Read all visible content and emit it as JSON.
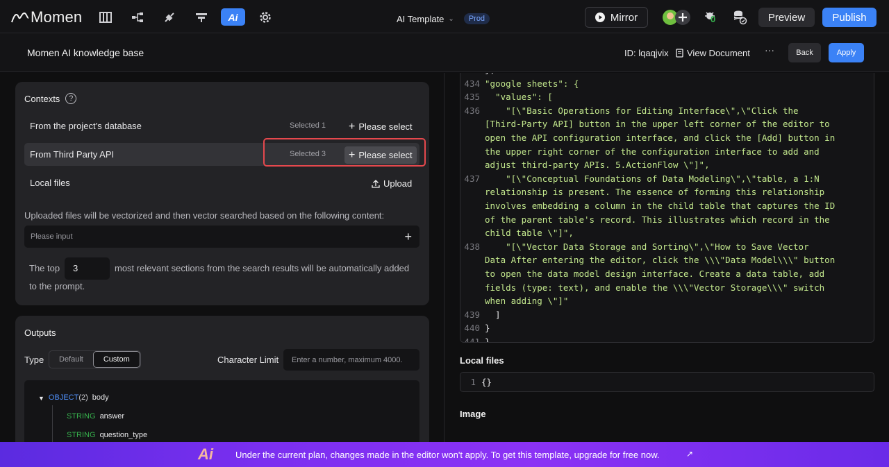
{
  "topbar": {
    "logo": "Momen",
    "template_name": "AI Template",
    "env_badge": "Prod",
    "mirror_label": "Mirror",
    "notification_count": "0",
    "preview_label": "Preview",
    "publish_label": "Publish"
  },
  "subbar": {
    "title": "Momen AI knowledge base",
    "id_text": "ID: lqaqjvix",
    "view_document": "View Document",
    "more": "···",
    "back_label": "Back",
    "apply_label": "Apply"
  },
  "contexts": {
    "title": "Contexts",
    "help": "?",
    "rows": [
      {
        "label": "From the project’s database",
        "selected": "Selected 1",
        "action": "Please select"
      },
      {
        "label": "From Third Party API",
        "selected": "Selected 3",
        "action": "Please select"
      },
      {
        "label": "Local files",
        "selected": "",
        "action": "Upload"
      }
    ],
    "hint": "Uploaded files will be vectorized and then vector searched based on the following content:",
    "input_placeholder": "Please input",
    "topn_prefix": "The top",
    "topn_value": "3",
    "topn_suffix": "most relevant sections from the search results will be automatically added",
    "topn_suffix2": "to the prompt."
  },
  "outputs": {
    "title": "Outputs",
    "type_label": "Type",
    "type_options": [
      "Default",
      "Custom"
    ],
    "type_selected": "Custom",
    "char_limit_label": "Character Limit",
    "char_limit_placeholder": "Enter a number, maximum 4000.",
    "tree": {
      "root_type": "OBJECT",
      "root_count": "(2)",
      "root_name": "body",
      "children": [
        {
          "type": "STRING",
          "name": "answer"
        },
        {
          "type": "STRING",
          "name": "question_type"
        }
      ]
    }
  },
  "code": {
    "lines": [
      {
        "n": "",
        "t": "},"
      },
      {
        "n": "434",
        "t": "\"google sheets\": {"
      },
      {
        "n": "435",
        "t": "  \"values\": ["
      },
      {
        "n": "436",
        "t": "    \"[\\\"Basic Operations for Editing Interface\\\",\\\"Click the"
      },
      {
        "n": "",
        "t": "[Third-Party API] button in the upper left corner of the editor to"
      },
      {
        "n": "",
        "t": "open the API configuration interface, and click the [Add] button in"
      },
      {
        "n": "",
        "t": "the upper right corner of the configuration interface to add and"
      },
      {
        "n": "",
        "t": "adjust third-party APIs. 5.ActionFlow \\\"]\","
      },
      {
        "n": "437",
        "t": "    \"[\\\"Conceptual Foundations of Data Modeling\\\",\\\"table, a 1:N"
      },
      {
        "n": "",
        "t": "relationship is present. The essence of forming this relationship"
      },
      {
        "n": "",
        "t": "involves embedding a column in the child table that captures the ID"
      },
      {
        "n": "",
        "t": "of the parent table's record. This illustrates which record in the"
      },
      {
        "n": "",
        "t": "child table \\\"]\","
      },
      {
        "n": "438",
        "t": "    \"[\\\"Vector Data Storage and Sorting\\\",\\\"How to Save Vector"
      },
      {
        "n": "",
        "t": "Data After entering the editor, click the \\\\\\\"Data Model\\\\\\\" button"
      },
      {
        "n": "",
        "t": "to open the data model design interface. Create a data table, add"
      },
      {
        "n": "",
        "t": "fields (type: text), and enable the \\\\\\\"Vector Storage\\\\\\\" switch"
      },
      {
        "n": "",
        "t": "when adding \\\"]\""
      },
      {
        "n": "439",
        "t": "  ]"
      },
      {
        "n": "440",
        "t": "}"
      },
      {
        "n": "441",
        "t": "}"
      }
    ]
  },
  "right": {
    "local_files_title": "Local files",
    "local_files_line": "1",
    "local_files_value": "{}",
    "image_title": "Image"
  },
  "banner": {
    "logo": "Ai",
    "message": "Under the current plan, changes made in the editor won't apply. To get this template, upgrade for free now.",
    "arrow": "↗"
  },
  "colors": {
    "accent": "#3b82f6",
    "highlight_border": "#e5484d",
    "string_type": "#37b24d",
    "object_type": "#4f8ef7",
    "code_string": "#c3e88d",
    "banner_start": "#5b2be0",
    "banner_end": "#8b32f5"
  }
}
